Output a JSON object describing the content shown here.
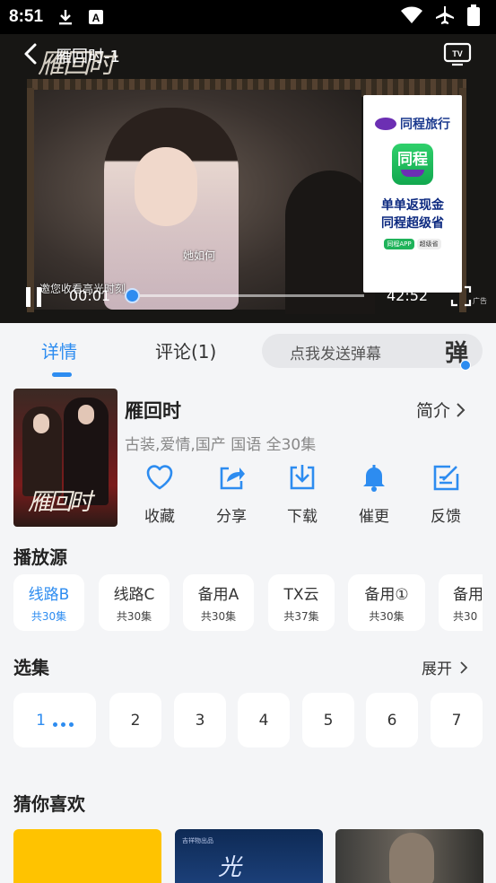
{
  "status_bar": {
    "time": "8:51"
  },
  "player": {
    "title": "雁回时-1",
    "subtitle": "她如何",
    "tiny_note": "邀您收看高光时刻",
    "current_time": "00:01",
    "duration": "42:52",
    "progress_fraction": 0.0004,
    "logo_text": "雁回时",
    "ad": {
      "brand": "同程旅行",
      "app_name": "同程",
      "line1": "单单返现金",
      "line2": "同程超级省",
      "foot_a": "同程APP",
      "foot_b": "超级省",
      "label": "广告"
    }
  },
  "tabs": [
    {
      "label": "详情",
      "active": true
    },
    {
      "label": "评论(1)",
      "active": false
    }
  ],
  "danmu": {
    "placeholder": "点我发送弹幕",
    "icon_text": "弹"
  },
  "show": {
    "title": "雁回时",
    "intro_label": "简介",
    "meta": "古装,爱情,国产 国语 全30集",
    "poster_text": "雁回时"
  },
  "actions": [
    {
      "label": "收藏",
      "icon": "heart-icon"
    },
    {
      "label": "分享",
      "icon": "share-icon"
    },
    {
      "label": "下载",
      "icon": "download-icon"
    },
    {
      "label": "催更",
      "icon": "bell-icon"
    },
    {
      "label": "反馈",
      "icon": "feedback-icon"
    }
  ],
  "sources_title": "播放源",
  "sources": [
    {
      "name": "线路B",
      "count": "共30集",
      "active": true
    },
    {
      "name": "线路C",
      "count": "共30集",
      "active": false
    },
    {
      "name": "备用A",
      "count": "共30集",
      "active": false
    },
    {
      "name": "TX云",
      "count": "共37集",
      "active": false
    },
    {
      "name": "备用①",
      "count": "共30集",
      "active": false
    },
    {
      "name": "备用",
      "count": "共30",
      "active": false
    }
  ],
  "episodes_title": "选集",
  "expand_label": "展开",
  "episodes": [
    "1",
    "2",
    "3",
    "4",
    "5",
    "6",
    "7"
  ],
  "recommend_title": "猜你喜欢",
  "recommend_cards": [
    {
      "title": ""
    },
    {
      "title": "光",
      "small": "吉祥物出品"
    },
    {
      "title": ""
    }
  ],
  "colors": {
    "accent": "#2d8cf0",
    "background": "#f4f5f7",
    "text": "#222222",
    "muted": "#888888"
  }
}
